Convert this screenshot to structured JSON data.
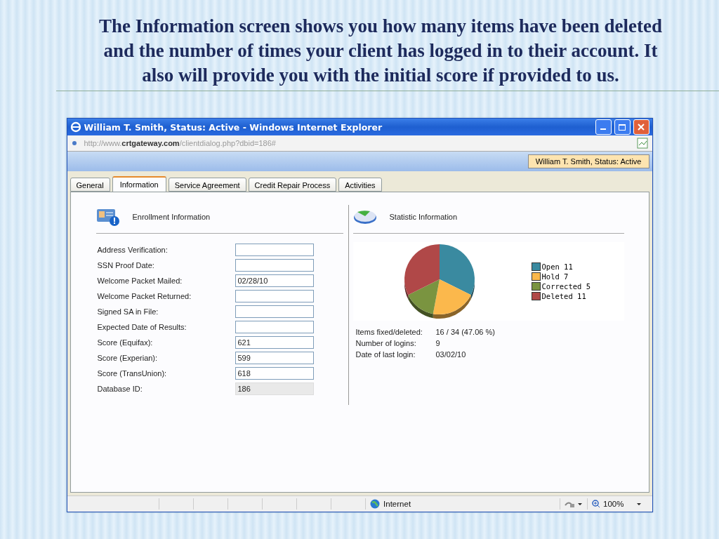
{
  "slide": {
    "heading": "The Information screen shows you how many items have been deleted and the number of times your client has logged in to their account.  It also will provide you with the initial score if provided to us."
  },
  "window": {
    "title": "William T. Smith, Status: Active - Windows Internet Explorer"
  },
  "address_bar": {
    "url": "http://www.**crtgateway.com**/clientdialog.php?dbid=186#"
  },
  "status_badge": "William T. Smith, Status: Active",
  "tabs": [
    {
      "label": "General",
      "selected": false
    },
    {
      "label": "Information",
      "selected": true
    },
    {
      "label": "Service Agreement",
      "selected": false
    },
    {
      "label": "Credit Repair Process",
      "selected": false
    },
    {
      "label": "Activities",
      "selected": false
    }
  ],
  "enrollment": {
    "title": "Enrollment Information",
    "fields": [
      {
        "label": "Address Verification:",
        "disabled": false
      },
      {
        "label": "SSN Proof Date:",
        "disabled": false
      },
      {
        "label": "Welcome Packet Mailed:",
        "value": "02/28/10",
        "disabled": false
      },
      {
        "label": "Welcome Packet Returned:",
        "disabled": false
      },
      {
        "label": "Signed SA in File:",
        "disabled": false
      },
      {
        "label": "Expected Date of Results:",
        "disabled": false
      },
      {
        "label": "Score (Equifax):",
        "value": "621",
        "disabled": false
      },
      {
        "label": "Score (Experian):",
        "value": "599",
        "disabled": false
      },
      {
        "label": "Score (TransUnion):",
        "value": "618",
        "disabled": false
      },
      {
        "label": "Database ID:",
        "value": "186",
        "disabled": true
      }
    ]
  },
  "statistics": {
    "title": "Statistic Information",
    "chart_data": {
      "type": "pie",
      "categories": [
        "Open 11",
        "Hold 7",
        "Corrected 5",
        "Deleted 11"
      ],
      "values": [
        11,
        7,
        5,
        11
      ],
      "colors": [
        "#3a8aa0",
        "#fbb84c",
        "#7a9440",
        "#b04848"
      ]
    },
    "rows": [
      {
        "label": "Items fixed/deleted:",
        "value": "16 / 34 (47.06 %)"
      },
      {
        "label": "Number of logins:",
        "value": "9"
      },
      {
        "label": "Date of last login:",
        "value": "03/02/10"
      }
    ]
  },
  "status_bar": {
    "zone": "Internet",
    "zoom": "100%"
  }
}
